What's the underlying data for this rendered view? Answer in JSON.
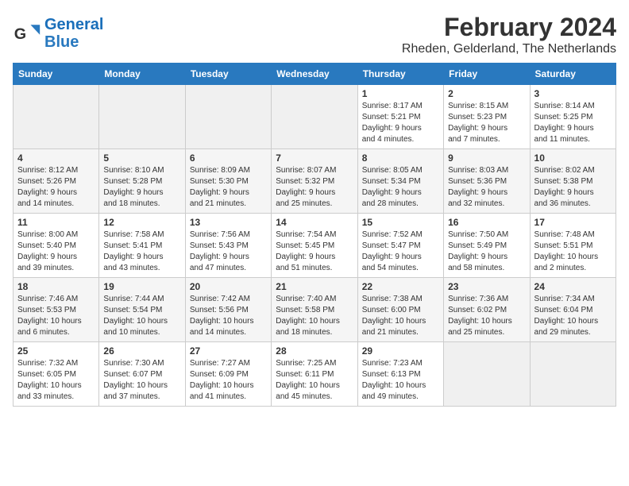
{
  "header": {
    "logo_text_general": "General",
    "logo_text_blue": "Blue",
    "month_year": "February 2024",
    "location": "Rheden, Gelderland, The Netherlands"
  },
  "calendar": {
    "days_of_week": [
      "Sunday",
      "Monday",
      "Tuesday",
      "Wednesday",
      "Thursday",
      "Friday",
      "Saturday"
    ],
    "weeks": [
      [
        {
          "day": "",
          "info": ""
        },
        {
          "day": "",
          "info": ""
        },
        {
          "day": "",
          "info": ""
        },
        {
          "day": "",
          "info": ""
        },
        {
          "day": "1",
          "info": "Sunrise: 8:17 AM\nSunset: 5:21 PM\nDaylight: 9 hours\nand 4 minutes."
        },
        {
          "day": "2",
          "info": "Sunrise: 8:15 AM\nSunset: 5:23 PM\nDaylight: 9 hours\nand 7 minutes."
        },
        {
          "day": "3",
          "info": "Sunrise: 8:14 AM\nSunset: 5:25 PM\nDaylight: 9 hours\nand 11 minutes."
        }
      ],
      [
        {
          "day": "4",
          "info": "Sunrise: 8:12 AM\nSunset: 5:26 PM\nDaylight: 9 hours\nand 14 minutes."
        },
        {
          "day": "5",
          "info": "Sunrise: 8:10 AM\nSunset: 5:28 PM\nDaylight: 9 hours\nand 18 minutes."
        },
        {
          "day": "6",
          "info": "Sunrise: 8:09 AM\nSunset: 5:30 PM\nDaylight: 9 hours\nand 21 minutes."
        },
        {
          "day": "7",
          "info": "Sunrise: 8:07 AM\nSunset: 5:32 PM\nDaylight: 9 hours\nand 25 minutes."
        },
        {
          "day": "8",
          "info": "Sunrise: 8:05 AM\nSunset: 5:34 PM\nDaylight: 9 hours\nand 28 minutes."
        },
        {
          "day": "9",
          "info": "Sunrise: 8:03 AM\nSunset: 5:36 PM\nDaylight: 9 hours\nand 32 minutes."
        },
        {
          "day": "10",
          "info": "Sunrise: 8:02 AM\nSunset: 5:38 PM\nDaylight: 9 hours\nand 36 minutes."
        }
      ],
      [
        {
          "day": "11",
          "info": "Sunrise: 8:00 AM\nSunset: 5:40 PM\nDaylight: 9 hours\nand 39 minutes."
        },
        {
          "day": "12",
          "info": "Sunrise: 7:58 AM\nSunset: 5:41 PM\nDaylight: 9 hours\nand 43 minutes."
        },
        {
          "day": "13",
          "info": "Sunrise: 7:56 AM\nSunset: 5:43 PM\nDaylight: 9 hours\nand 47 minutes."
        },
        {
          "day": "14",
          "info": "Sunrise: 7:54 AM\nSunset: 5:45 PM\nDaylight: 9 hours\nand 51 minutes."
        },
        {
          "day": "15",
          "info": "Sunrise: 7:52 AM\nSunset: 5:47 PM\nDaylight: 9 hours\nand 54 minutes."
        },
        {
          "day": "16",
          "info": "Sunrise: 7:50 AM\nSunset: 5:49 PM\nDaylight: 9 hours\nand 58 minutes."
        },
        {
          "day": "17",
          "info": "Sunrise: 7:48 AM\nSunset: 5:51 PM\nDaylight: 10 hours\nand 2 minutes."
        }
      ],
      [
        {
          "day": "18",
          "info": "Sunrise: 7:46 AM\nSunset: 5:53 PM\nDaylight: 10 hours\nand 6 minutes."
        },
        {
          "day": "19",
          "info": "Sunrise: 7:44 AM\nSunset: 5:54 PM\nDaylight: 10 hours\nand 10 minutes."
        },
        {
          "day": "20",
          "info": "Sunrise: 7:42 AM\nSunset: 5:56 PM\nDaylight: 10 hours\nand 14 minutes."
        },
        {
          "day": "21",
          "info": "Sunrise: 7:40 AM\nSunset: 5:58 PM\nDaylight: 10 hours\nand 18 minutes."
        },
        {
          "day": "22",
          "info": "Sunrise: 7:38 AM\nSunset: 6:00 PM\nDaylight: 10 hours\nand 21 minutes."
        },
        {
          "day": "23",
          "info": "Sunrise: 7:36 AM\nSunset: 6:02 PM\nDaylight: 10 hours\nand 25 minutes."
        },
        {
          "day": "24",
          "info": "Sunrise: 7:34 AM\nSunset: 6:04 PM\nDaylight: 10 hours\nand 29 minutes."
        }
      ],
      [
        {
          "day": "25",
          "info": "Sunrise: 7:32 AM\nSunset: 6:05 PM\nDaylight: 10 hours\nand 33 minutes."
        },
        {
          "day": "26",
          "info": "Sunrise: 7:30 AM\nSunset: 6:07 PM\nDaylight: 10 hours\nand 37 minutes."
        },
        {
          "day": "27",
          "info": "Sunrise: 7:27 AM\nSunset: 6:09 PM\nDaylight: 10 hours\nand 41 minutes."
        },
        {
          "day": "28",
          "info": "Sunrise: 7:25 AM\nSunset: 6:11 PM\nDaylight: 10 hours\nand 45 minutes."
        },
        {
          "day": "29",
          "info": "Sunrise: 7:23 AM\nSunset: 6:13 PM\nDaylight: 10 hours\nand 49 minutes."
        },
        {
          "day": "",
          "info": ""
        },
        {
          "day": "",
          "info": ""
        }
      ]
    ]
  }
}
